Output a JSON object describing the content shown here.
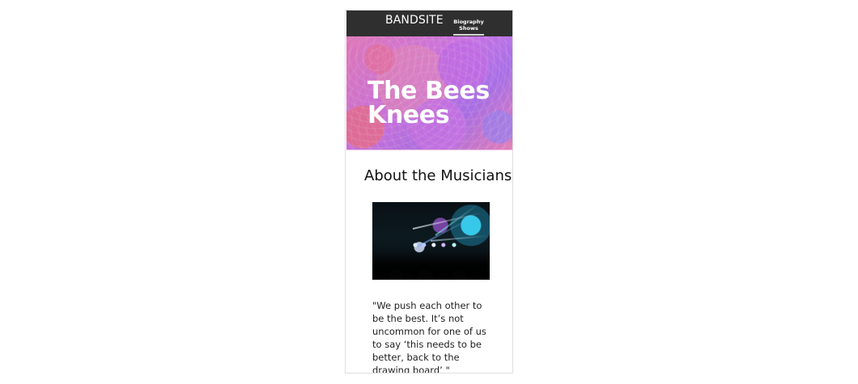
{
  "nav": {
    "brand": "BANDSITE",
    "links": [
      "Biography",
      "Shows"
    ]
  },
  "hero": {
    "title": "The Bees Knees"
  },
  "about": {
    "title": "About the Musicians",
    "quote": "\"We push each other to be the best. It’s not uncommon for one of us to say ‘this needs to be better, back to the drawing board’ \""
  },
  "colors": {
    "nav_background": "#2f2f2f",
    "nav_text": "#ffffff",
    "hero_pink": "#ff8bd6",
    "hero_purple": "#df82ff",
    "body_text": "#111111"
  },
  "icons": [
    "concert-photo"
  ]
}
